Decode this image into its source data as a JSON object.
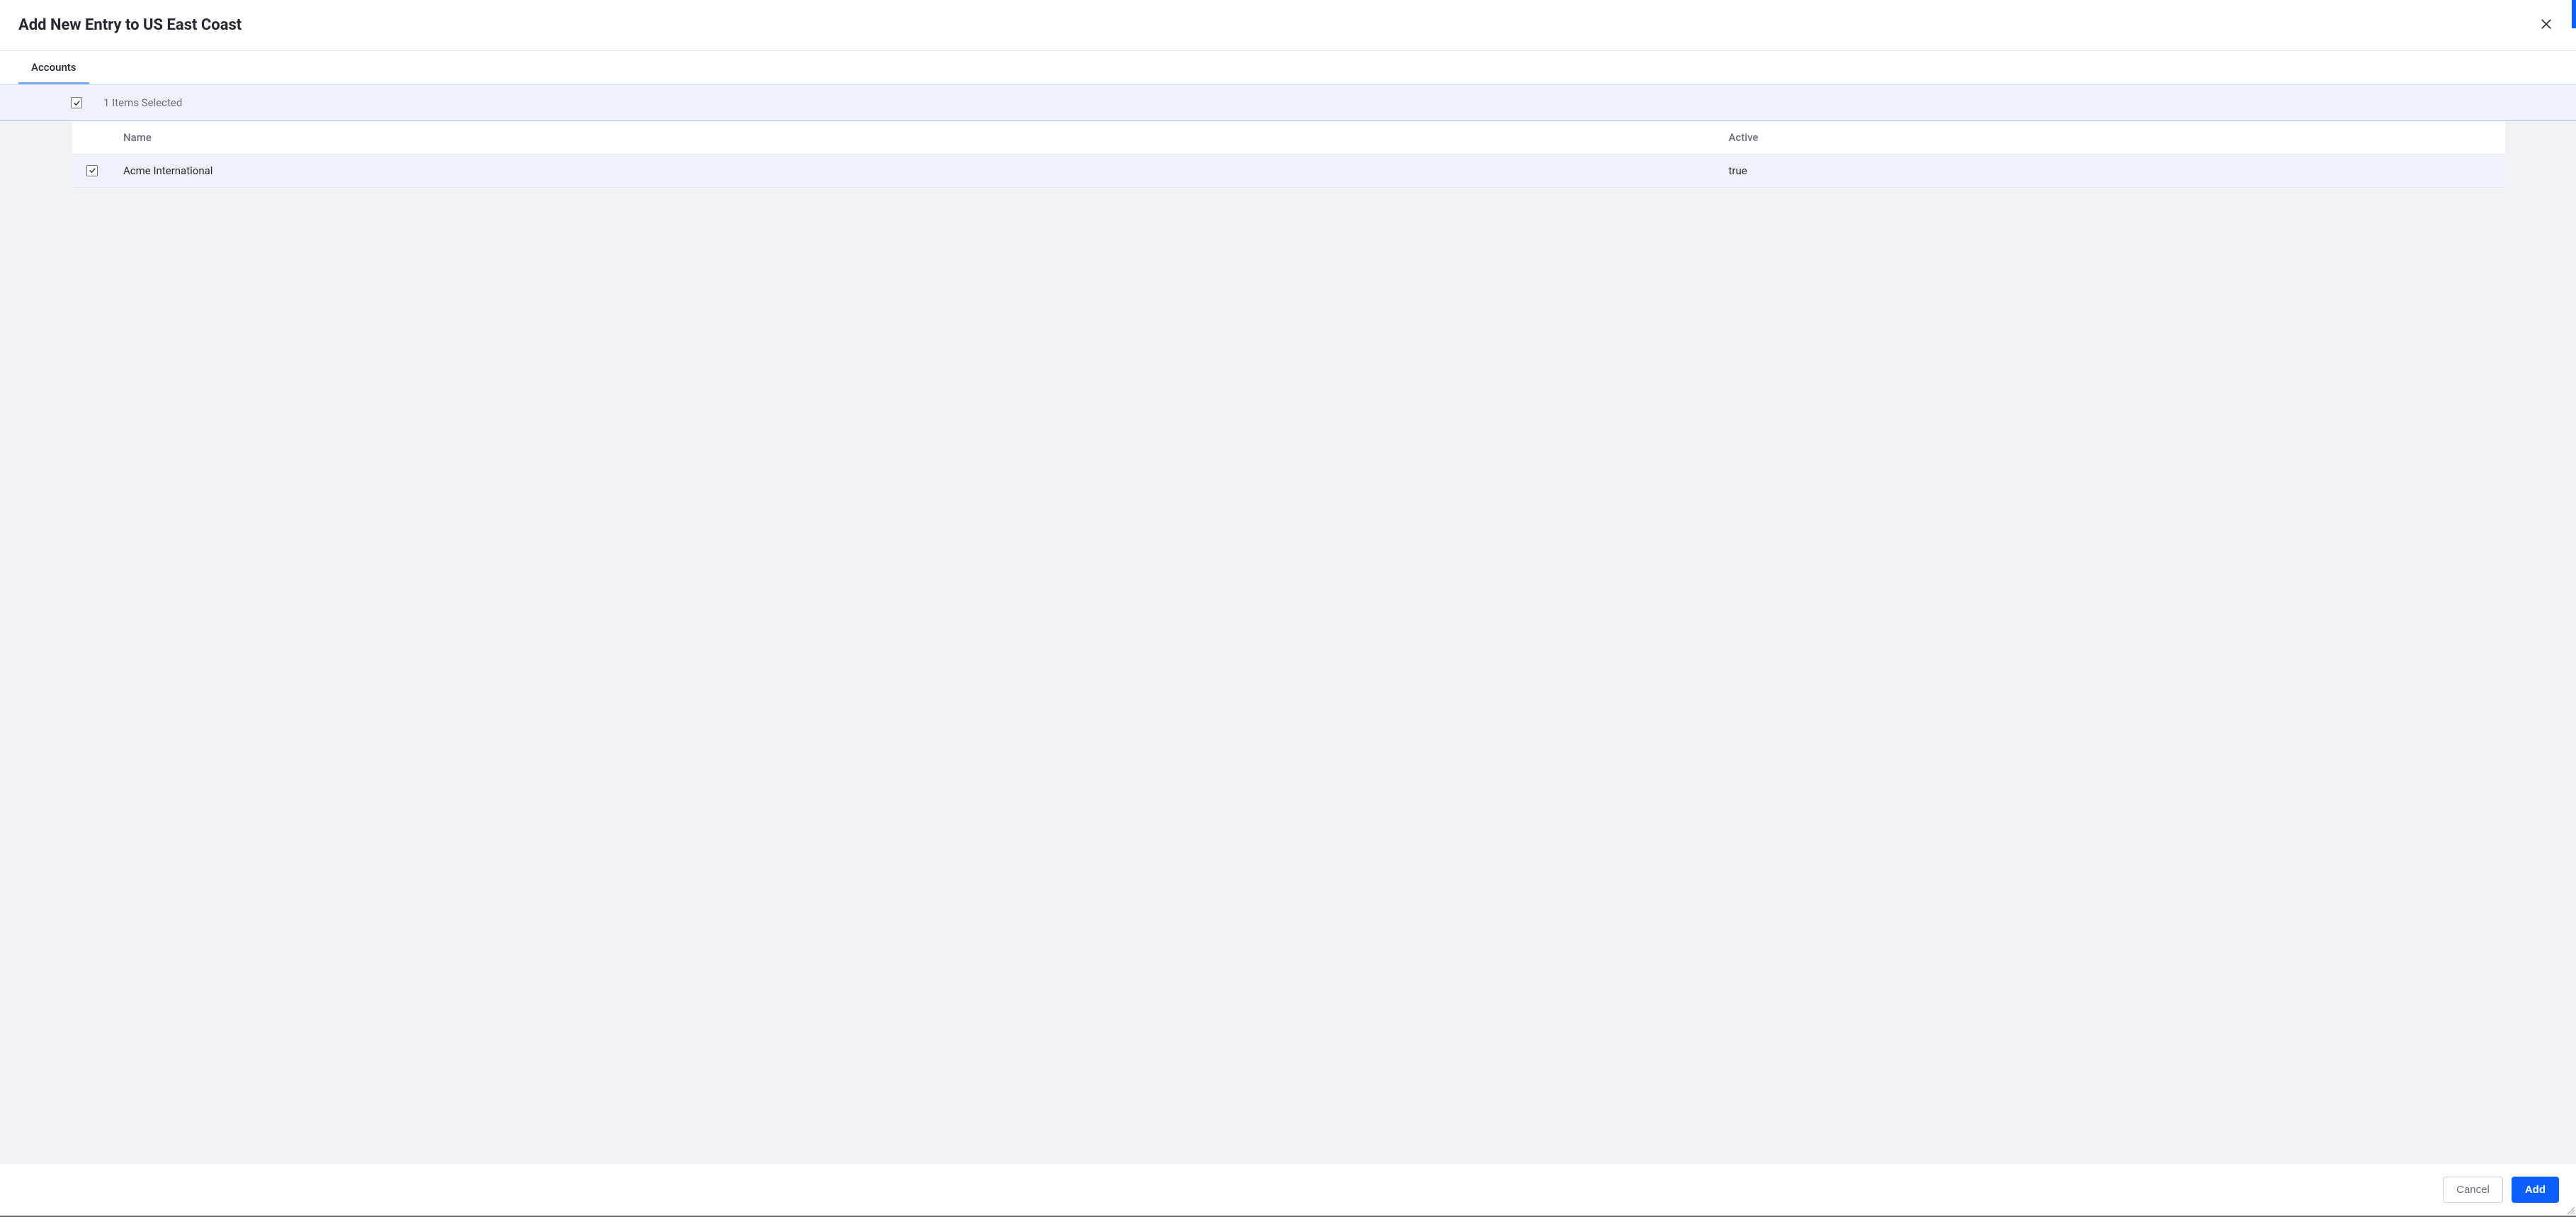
{
  "modal": {
    "title": "Add New Entry to US East Coast",
    "tabs": [
      {
        "label": "Accounts"
      }
    ],
    "selection_summary": "1 Items Selected",
    "columns": {
      "name": "Name",
      "active": "Active"
    },
    "rows": [
      {
        "name": "Acme International",
        "active": "true"
      }
    ],
    "footer": {
      "cancel": "Cancel",
      "add": "Add"
    }
  }
}
